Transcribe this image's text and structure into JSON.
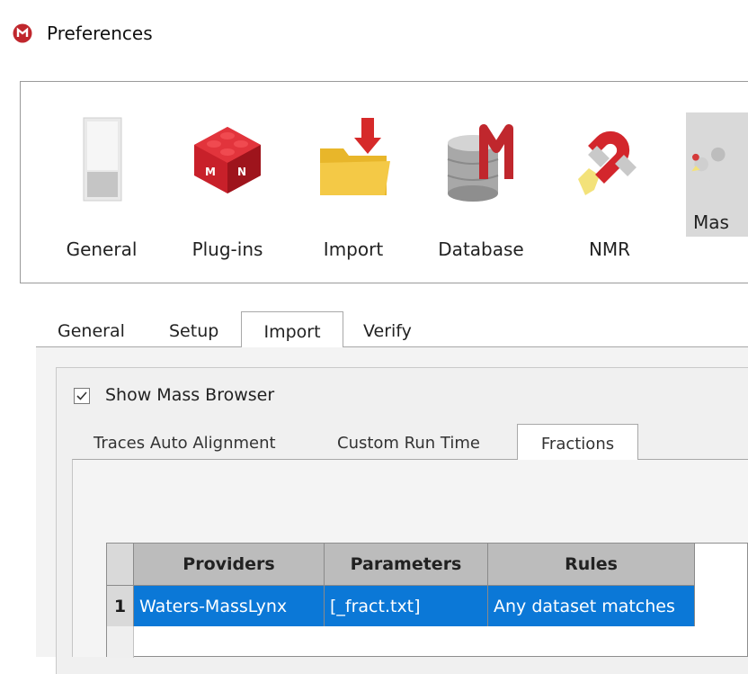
{
  "window": {
    "title": "Preferences"
  },
  "toolbar": {
    "items": [
      {
        "label": "General",
        "icon": "switch-icon"
      },
      {
        "label": "Plug-ins",
        "icon": "lego-brick-icon"
      },
      {
        "label": "Import",
        "icon": "import-folder-icon"
      },
      {
        "label": "Database",
        "icon": "database-icon"
      },
      {
        "label": "NMR",
        "icon": "magnet-icon"
      },
      {
        "label": "Mas",
        "icon": "mass-molecule-icon"
      }
    ],
    "selected": "Mas"
  },
  "main_tabs": {
    "items": [
      "General",
      "Setup",
      "Import",
      "Verify"
    ],
    "active": "Import"
  },
  "show_mass_browser": {
    "label": "Show Mass Browser",
    "checked": true
  },
  "sub_tabs": {
    "items": [
      "Traces Auto Alignment",
      "Custom Run Time",
      "Fractions"
    ],
    "active": "Fractions"
  },
  "table": {
    "headers": [
      "Providers",
      "Parameters",
      "Rules"
    ],
    "rows": [
      {
        "num": "1",
        "providers": "Waters-MassLynx",
        "parameters": "[_fract.txt]",
        "rules": "Any dataset matches"
      }
    ]
  },
  "colors": {
    "selection": "#0b78d7",
    "header": "#bcbcbc",
    "app_icon": "#c0272d"
  }
}
